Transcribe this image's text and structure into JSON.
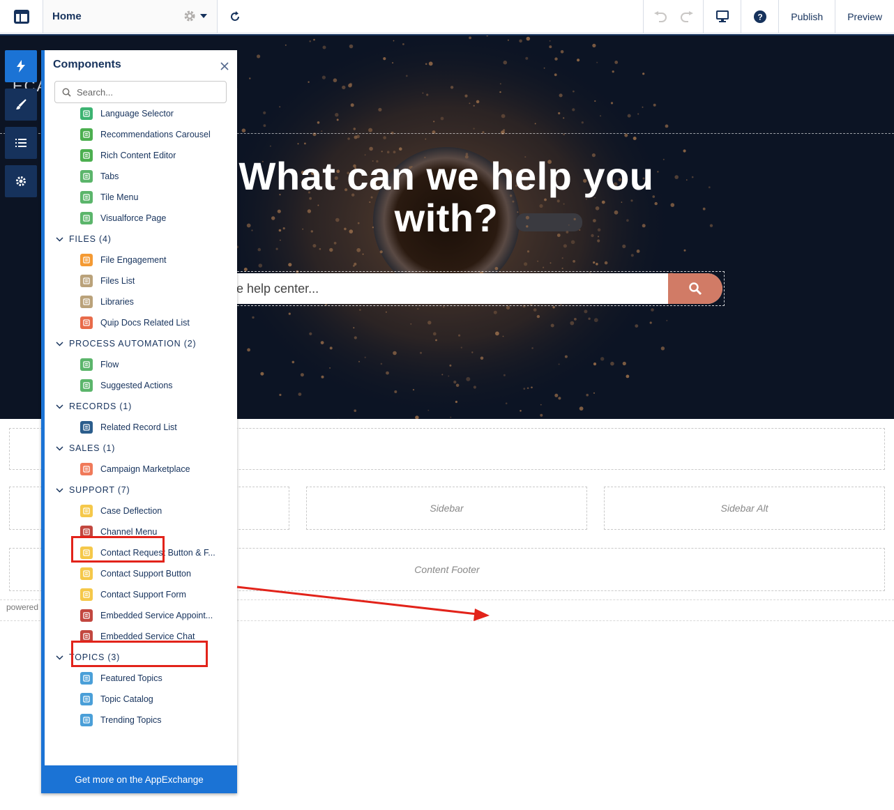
{
  "topbar": {
    "page_name": "Home",
    "publish_label": "Publish",
    "preview_label": "Preview"
  },
  "hero": {
    "title": "What can we help you with?",
    "search_text": "e help center...",
    "partial_text": "ECA"
  },
  "regions": {
    "sidebar": "Sidebar",
    "sidebar_alt": "Sidebar Alt",
    "content_footer": "Content Footer",
    "powered": "powered"
  },
  "panel": {
    "title": "Components",
    "search_placeholder": "Search...",
    "footer_label": "Get more on the AppExchange",
    "rows": [
      {
        "kind": "item",
        "label": "Language Selector",
        "color": "#3cb371",
        "icon": "language-selector-icon"
      },
      {
        "kind": "item",
        "label": "Recommendations Carousel",
        "color": "#4caf50",
        "icon": "recommendations-icon"
      },
      {
        "kind": "item",
        "label": "Rich Content Editor",
        "color": "#4caf50",
        "icon": "rich-content-icon"
      },
      {
        "kind": "item",
        "label": "Tabs",
        "color": "#5bb56b",
        "icon": "tabs-icon"
      },
      {
        "kind": "item",
        "label": "Tile Menu",
        "color": "#5bb56b",
        "icon": "tile-menu-icon"
      },
      {
        "kind": "item",
        "label": "Visualforce Page",
        "color": "#5bb56b",
        "icon": "visualforce-icon"
      },
      {
        "kind": "section",
        "label": "FILES (4)"
      },
      {
        "kind": "item",
        "label": "File Engagement",
        "color": "#f49a33",
        "icon": "file-engagement-icon"
      },
      {
        "kind": "item",
        "label": "Files List",
        "color": "#baa27a",
        "icon": "files-list-icon"
      },
      {
        "kind": "item",
        "label": "Libraries",
        "color": "#baa27a",
        "icon": "libraries-icon"
      },
      {
        "kind": "item",
        "label": "Quip Docs Related List",
        "color": "#e86b4a",
        "icon": "quip-icon"
      },
      {
        "kind": "section",
        "label": "PROCESS AUTOMATION (2)"
      },
      {
        "kind": "item",
        "label": "Flow",
        "color": "#5bb56b",
        "icon": "flow-icon"
      },
      {
        "kind": "item",
        "label": "Suggested Actions",
        "color": "#5bb56b",
        "icon": "suggested-actions-icon"
      },
      {
        "kind": "section",
        "label": "RECORDS (1)"
      },
      {
        "kind": "item",
        "label": "Related Record List",
        "color": "#2b5d8c",
        "icon": "related-record-icon"
      },
      {
        "kind": "section",
        "label": "SALES (1)"
      },
      {
        "kind": "item",
        "label": "Campaign Marketplace",
        "color": "#f07a5a",
        "icon": "campaign-icon"
      },
      {
        "kind": "section",
        "label": "SUPPORT (7)"
      },
      {
        "kind": "item",
        "label": "Case Deflection",
        "color": "#f5c84a",
        "icon": "case-deflection-icon"
      },
      {
        "kind": "item",
        "label": "Channel Menu",
        "color": "#c2473f",
        "icon": "channel-menu-icon"
      },
      {
        "kind": "item",
        "label": "Contact Request Button & F...",
        "color": "#f5c84a",
        "icon": "contact-request-icon"
      },
      {
        "kind": "item",
        "label": "Contact Support Button",
        "color": "#f5c84a",
        "icon": "contact-support-button-icon"
      },
      {
        "kind": "item",
        "label": "Contact Support Form",
        "color": "#f5c84a",
        "icon": "contact-support-form-icon"
      },
      {
        "kind": "item",
        "label": "Embedded Service Appoint...",
        "color": "#c2473f",
        "icon": "embedded-appointment-icon"
      },
      {
        "kind": "item",
        "label": "Embedded Service Chat",
        "color": "#c2473f",
        "icon": "embedded-chat-icon"
      },
      {
        "kind": "section",
        "label": "TOPICS (3)"
      },
      {
        "kind": "item",
        "label": "Featured Topics",
        "color": "#4a9fd8",
        "icon": "featured-topics-icon"
      },
      {
        "kind": "item",
        "label": "Topic Catalog",
        "color": "#4a9fd8",
        "icon": "topic-catalog-icon"
      },
      {
        "kind": "item",
        "label": "Trending Topics",
        "color": "#4a9fd8",
        "icon": "trending-topics-icon"
      }
    ]
  },
  "colors": {
    "accent": "#1b73d5",
    "navy": "#16325c",
    "highlight": "#e2231a",
    "search_button": "#d17b66"
  }
}
